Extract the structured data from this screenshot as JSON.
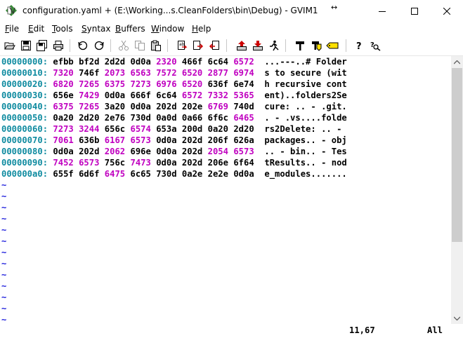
{
  "window": {
    "title": "configuration.yaml + (E:\\Working...s.CleanFolders\\bin\\Debug) - GVIM1"
  },
  "menu": [
    {
      "pre": "",
      "ul": "F",
      "post": "ile"
    },
    {
      "pre": "",
      "ul": "E",
      "post": "dit"
    },
    {
      "pre": "",
      "ul": "T",
      "post": "ools"
    },
    {
      "pre": "",
      "ul": "S",
      "post": "yntax"
    },
    {
      "pre": "",
      "ul": "B",
      "post": "uffers"
    },
    {
      "pre": "",
      "ul": "W",
      "post": "indow"
    },
    {
      "pre": "",
      "ul": "H",
      "post": "elp"
    }
  ],
  "toolbar": {
    "icons": [
      "open-icon",
      "save-icon",
      "save-all-icon",
      "print-icon",
      "undo-icon",
      "redo-icon",
      "cut-icon",
      "copy-icon",
      "paste-icon",
      "find-replace-icon",
      "find-next-icon",
      "find-prev-icon",
      "load-session-icon",
      "save-session-icon",
      "run-script-icon",
      "make-icon",
      "ctags-icon",
      "jump-tag-icon",
      "help-icon",
      "find-help-icon"
    ]
  },
  "buffer": {
    "lines": [
      {
        "addr": "00000000:",
        "hex": [
          [
            "efbb",
            0
          ],
          [
            "bf2d",
            0
          ],
          [
            "2d2d",
            0
          ],
          [
            "0d0a",
            0
          ],
          [
            "2320",
            1
          ],
          [
            "466f",
            0
          ],
          [
            "6c64",
            0
          ],
          [
            "6572",
            1
          ]
        ],
        "ascii": "...---..# Folder"
      },
      {
        "addr": "00000010:",
        "hex": [
          [
            "7320",
            1
          ],
          [
            "746f",
            0
          ],
          [
            "2073",
            1
          ],
          [
            "6563",
            1
          ],
          [
            "7572",
            1
          ],
          [
            "6520",
            1
          ],
          [
            "2877",
            1
          ],
          [
            "6974",
            1
          ]
        ],
        "ascii": "s to secure (wit"
      },
      {
        "addr": "00000020:",
        "hex": [
          [
            "6820",
            1
          ],
          [
            "7265",
            1
          ],
          [
            "6375",
            1
          ],
          [
            "7273",
            1
          ],
          [
            "6976",
            1
          ],
          [
            "6520",
            1
          ],
          [
            "636f",
            0
          ],
          [
            "6e74",
            0
          ]
        ],
        "ascii": "h recursive cont"
      },
      {
        "addr": "00000030:",
        "hex": [
          [
            "656e",
            0
          ],
          [
            "7429",
            1
          ],
          [
            "0d0a",
            0
          ],
          [
            "666f",
            0
          ],
          [
            "6c64",
            0
          ],
          [
            "6572",
            1
          ],
          [
            "7332",
            1
          ],
          [
            "5365",
            1
          ]
        ],
        "ascii": "ent)..folders2Se"
      },
      {
        "addr": "00000040:",
        "hex": [
          [
            "6375",
            1
          ],
          [
            "7265",
            1
          ],
          [
            "3a20",
            0
          ],
          [
            "0d0a",
            0
          ],
          [
            "202d",
            0
          ],
          [
            "202e",
            0
          ],
          [
            "6769",
            1
          ],
          [
            "740d",
            0
          ]
        ],
        "ascii": "cure: .. - .git."
      },
      {
        "addr": "00000050:",
        "hex": [
          [
            "0a20",
            0
          ],
          [
            "2d20",
            0
          ],
          [
            "2e76",
            0
          ],
          [
            "730d",
            0
          ],
          [
            "0a0d",
            0
          ],
          [
            "0a66",
            0
          ],
          [
            "6f6c",
            0
          ],
          [
            "6465",
            1
          ]
        ],
        "ascii": ". - .vs....folde"
      },
      {
        "addr": "00000060:",
        "hex": [
          [
            "7273",
            1
          ],
          [
            "3244",
            1
          ],
          [
            "656c",
            0
          ],
          [
            "6574",
            1
          ],
          [
            "653a",
            0
          ],
          [
            "200d",
            0
          ],
          [
            "0a20",
            0
          ],
          [
            "2d20",
            0
          ]
        ],
        "ascii": "rs2Delete: .. - "
      },
      {
        "addr": "00000070:",
        "hex": [
          [
            "7061",
            1
          ],
          [
            "636b",
            0
          ],
          [
            "6167",
            1
          ],
          [
            "6573",
            1
          ],
          [
            "0d0a",
            0
          ],
          [
            "202d",
            0
          ],
          [
            "206f",
            0
          ],
          [
            "626a",
            0
          ]
        ],
        "ascii": "packages.. - obj"
      },
      {
        "addr": "00000080:",
        "hex": [
          [
            "0d0a",
            0
          ],
          [
            "202d",
            0
          ],
          [
            "2062",
            1
          ],
          [
            "696e",
            0
          ],
          [
            "0d0a",
            0
          ],
          [
            "202d",
            0
          ],
          [
            "2054",
            1
          ],
          [
            "6573",
            1
          ]
        ],
        "ascii": ".. - bin.. - Tes"
      },
      {
        "addr": "00000090:",
        "hex": [
          [
            "7452",
            1
          ],
          [
            "6573",
            1
          ],
          [
            "756c",
            0
          ],
          [
            "7473",
            1
          ],
          [
            "0d0a",
            0
          ],
          [
            "202d",
            0
          ],
          [
            "206e",
            0
          ],
          [
            "6f64",
            0
          ]
        ],
        "ascii": "tResults.. - nod"
      },
      {
        "addr": "000000a0:",
        "hex": [
          [
            "655f",
            0
          ],
          [
            "6d6f",
            0
          ],
          [
            "6475",
            1
          ],
          [
            "6c65",
            0
          ],
          [
            "730d",
            0
          ],
          [
            "0a2e",
            0
          ],
          [
            "2e2e",
            0
          ],
          [
            "0d0a",
            0
          ]
        ],
        "ascii": "e_modules......."
      }
    ],
    "tilde": "~",
    "tilde_count": 13
  },
  "status": {
    "position": "11,67",
    "percent": "All"
  },
  "colors": {
    "address": "#0f8ba0",
    "hex_magenta": "#c000c0",
    "tilde": "#2222dd"
  }
}
